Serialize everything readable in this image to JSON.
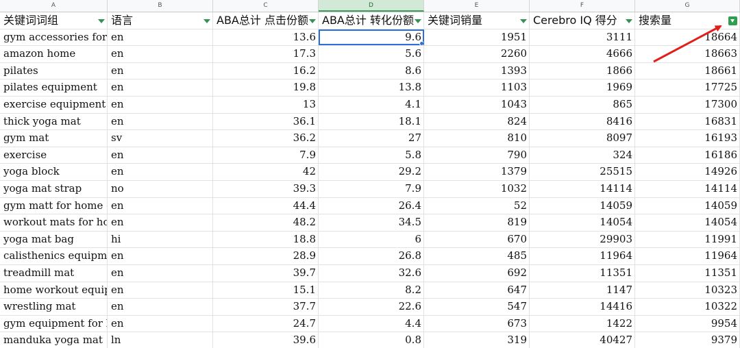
{
  "columns": [
    {
      "letter": "A",
      "header": "关键词词组"
    },
    {
      "letter": "B",
      "header": "语言"
    },
    {
      "letter": "C",
      "header": "ABA总计 点击份额"
    },
    {
      "letter": "D",
      "header": "ABA总计 转化份额"
    },
    {
      "letter": "E",
      "header": "关键词销量"
    },
    {
      "letter": "F",
      "header": "Cerebro IQ 得分"
    },
    {
      "letter": "G",
      "header": "搜索量"
    }
  ],
  "rows": [
    [
      "gym accessories for men",
      "en",
      "13.6",
      "9.6",
      "1951",
      "3111",
      "18664"
    ],
    [
      "amazon home",
      "en",
      "17.3",
      "5.6",
      "2260",
      "4666",
      "18663"
    ],
    [
      "pilates",
      "en",
      "16.2",
      "8.6",
      "1393",
      "1866",
      "18661"
    ],
    [
      "pilates equipment",
      "en",
      "19.8",
      "13.8",
      "1103",
      "1969",
      "17725"
    ],
    [
      "exercise equipment for home",
      "en",
      "13",
      "4.1",
      "1043",
      "865",
      "17300"
    ],
    [
      "thick yoga mat",
      "en",
      "36.1",
      "18.1",
      "824",
      "8416",
      "16831"
    ],
    [
      "gym mat",
      "sv",
      "36.2",
      "27",
      "810",
      "8097",
      "16193"
    ],
    [
      "exercise",
      "en",
      "7.9",
      "5.8",
      "790",
      "324",
      "16186"
    ],
    [
      "yoga block",
      "en",
      "42",
      "29.2",
      "1379",
      "25515",
      "14926"
    ],
    [
      "yoga mat strap",
      "no",
      "39.3",
      "7.9",
      "1032",
      "14114",
      "14114"
    ],
    [
      "gym matt for home gym",
      "en",
      "44.4",
      "26.4",
      "52",
      "14059",
      "14059"
    ],
    [
      "workout mats for home",
      "en",
      "48.2",
      "34.5",
      "819",
      "14054",
      "14054"
    ],
    [
      "yoga mat bag",
      "hi",
      "18.8",
      "6",
      "670",
      "29903",
      "11991"
    ],
    [
      "calisthenics equipment",
      "en",
      "28.9",
      "26.8",
      "485",
      "11964",
      "11964"
    ],
    [
      "treadmill mat",
      "en",
      "39.7",
      "32.6",
      "692",
      "11351",
      "11351"
    ],
    [
      "home workout equipment",
      "en",
      "15.1",
      "8.2",
      "647",
      "1147",
      "10323"
    ],
    [
      "wrestling mat",
      "en",
      "37.7",
      "22.6",
      "547",
      "14416",
      "10322"
    ],
    [
      "gym equipment for home",
      "en",
      "24.7",
      "4.4",
      "673",
      "1422",
      "9954"
    ],
    [
      "manduka yoga mat",
      "ln",
      "39.6",
      "0.8",
      "319",
      "40427",
      "9379"
    ]
  ],
  "selected_column": "D",
  "active_cell": {
    "column": "D",
    "row": 1
  },
  "active_filter_column": "G",
  "colors": {
    "accent": "#2f9e4f",
    "selection": "#2d6fd6",
    "arrow": "#e0201c"
  }
}
